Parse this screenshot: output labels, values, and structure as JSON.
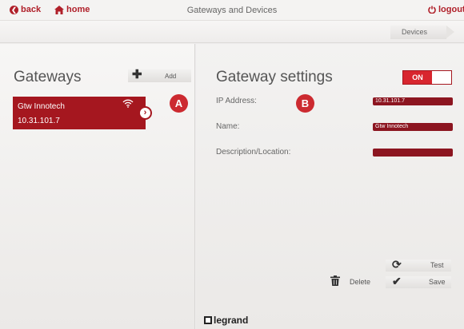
{
  "topbar": {
    "back_label": "back",
    "home_label": "home",
    "title": "Gateways and Devices",
    "logout_label": "logout"
  },
  "subbar": {
    "devices_tab": "Devices"
  },
  "left": {
    "title": "Gateways",
    "add_label": "Add",
    "gateways": [
      {
        "name": "Gtw Innotech",
        "ip": "10.31.101.7"
      }
    ]
  },
  "markers": {
    "a": "A",
    "b": "B"
  },
  "right": {
    "title": "Gateway settings",
    "toggle_label": "ON",
    "fields": [
      {
        "label": "IP Address:",
        "value": "10.31.101.7"
      },
      {
        "label": "Name:",
        "value": "Gtw Innotech"
      },
      {
        "label": "Description/Location:",
        "value": ""
      }
    ],
    "test_label": "Test",
    "delete_label": "Delete",
    "save_label": "Save"
  },
  "brand": {
    "logo_text": "legrand"
  },
  "colors": {
    "accent": "#b0202a",
    "card": "#a5171f",
    "field": "#8c1520"
  }
}
